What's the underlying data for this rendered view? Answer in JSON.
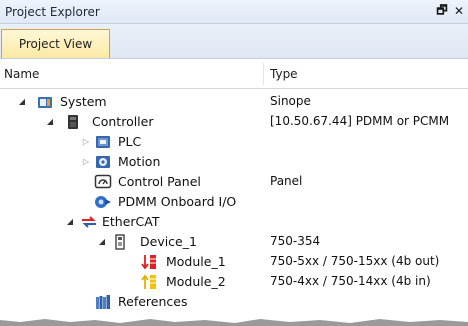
{
  "window": {
    "title": "Project Explorer",
    "restore_icon": "restore-window-icon",
    "close_icon": "close-icon",
    "restore_glyph": "🗗",
    "close_glyph": "✕"
  },
  "tabs": [
    {
      "label": "Project View",
      "active": true
    }
  ],
  "columns": {
    "name": "Name",
    "type": "Type"
  },
  "tree": [
    {
      "label": "System",
      "type": "Sinope",
      "icon": "system-icon",
      "expanded": true
    },
    {
      "label": "Controller",
      "type": "[10.50.67.44] PDMM or PCMM",
      "icon": "controller-icon",
      "expanded": true
    },
    {
      "label": "PLC",
      "type": "",
      "icon": "plc-icon",
      "expanded": false
    },
    {
      "label": "Motion",
      "type": "",
      "icon": "motion-icon",
      "expanded": false
    },
    {
      "label": "Control Panel",
      "type": "Panel",
      "icon": "control-panel-icon"
    },
    {
      "label": "PDMM Onboard I/O",
      "type": "",
      "icon": "onboard-io-icon"
    },
    {
      "label": "EtherCAT",
      "type": "",
      "icon": "ethercat-icon",
      "expanded": true
    },
    {
      "label": "Device_1",
      "type": "750-354",
      "icon": "device-icon",
      "expanded": true
    },
    {
      "label": "Module_1",
      "type": "750-5xx / 750-15xx (4b out)",
      "icon": "output-module-icon"
    },
    {
      "label": "Module_2",
      "type": "750-4xx / 750-14xx (4b in)",
      "icon": "input-module-icon"
    },
    {
      "label": "References",
      "type": "",
      "icon": "references-icon"
    }
  ],
  "colors": {
    "tab_active": "#fbe9a4",
    "titlebar": "#dfe8f6",
    "ethercat_red": "#d22",
    "ethercat_blue": "#2a5fb0"
  }
}
